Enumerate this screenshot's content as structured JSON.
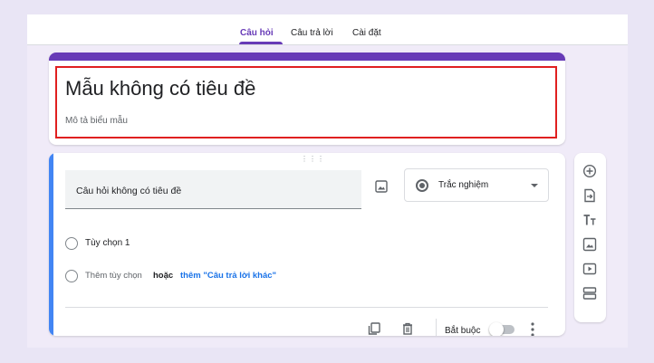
{
  "tabs": [
    {
      "label": "Câu hỏi",
      "active": true
    },
    {
      "label": "Câu trả lời",
      "active": false
    },
    {
      "label": "Cài đặt",
      "active": false
    }
  ],
  "form": {
    "title": "Mẫu không có tiêu đề",
    "description": "Mô tả biểu mẫu"
  },
  "question": {
    "title": "Câu hỏi không có tiêu đề",
    "type_label": "Trắc nghiệm",
    "options": [
      "Tùy chọn 1"
    ],
    "add_option": "Thêm tùy chọn",
    "or_label": "hoặc",
    "add_other": "thêm \"Câu trả lời khác\"",
    "required_label": "Bắt buộc",
    "required": false
  },
  "icons": {
    "image": "image-icon",
    "duplicate": "copy-icon",
    "delete": "trash-icon",
    "more": "more-vert-icon",
    "side_toolbar": [
      "add-circle-icon",
      "import-icon",
      "title-icon",
      "image-icon",
      "video-icon",
      "section-icon"
    ]
  },
  "colors": {
    "accent": "#673ab7",
    "active_question": "#4285f4",
    "link": "#1a73e8",
    "highlight": "#e02020",
    "background": "#f0ebf8"
  }
}
